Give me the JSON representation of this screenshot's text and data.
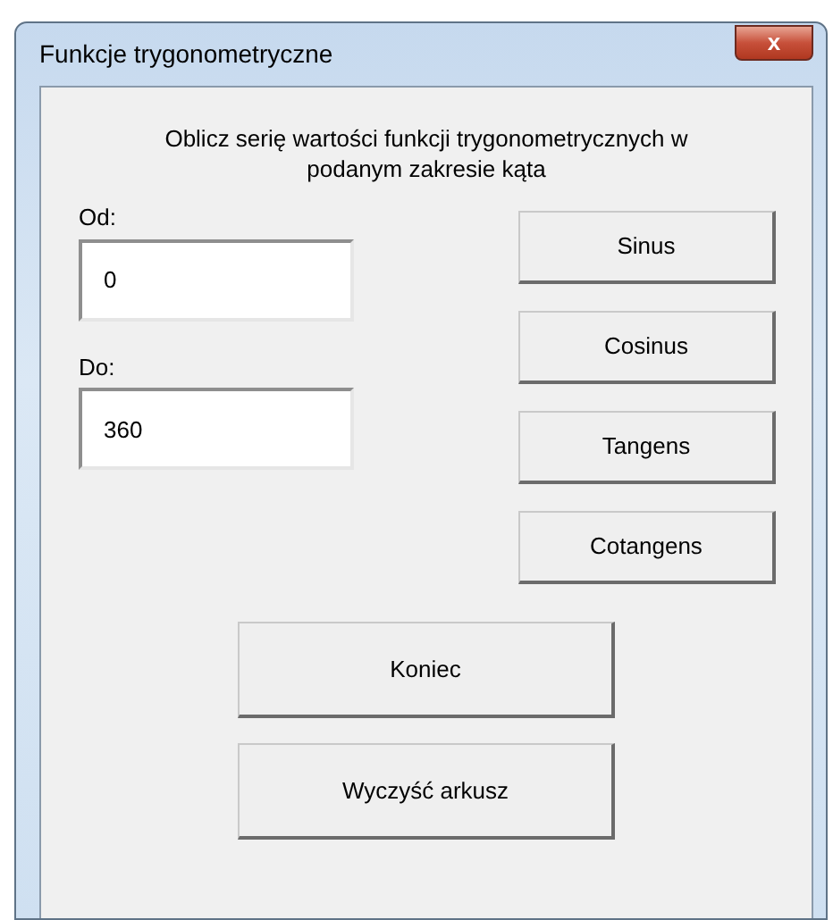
{
  "window": {
    "title": "Funkcje trygonometryczne",
    "close_button": "x"
  },
  "description": "Oblicz serię wartości funkcji trygonometrycznych w podanym zakresie kąta",
  "fields": [
    {
      "label": "Od:",
      "value": "0"
    },
    {
      "label": "Do:",
      "value": "360"
    }
  ],
  "function_buttons": [
    "Sinus",
    "Cosinus",
    "Tangens",
    "Cotangens"
  ],
  "bottom_buttons": [
    "Koniec",
    "Wyczyść arkusz"
  ]
}
